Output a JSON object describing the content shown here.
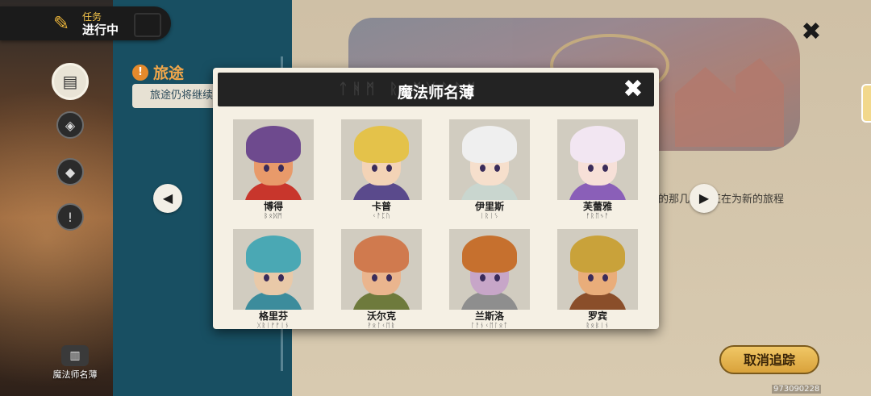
{
  "task": {
    "label": "任务",
    "status": "进行中"
  },
  "journey": {
    "title": "旅途",
    "text": "旅途仍将继续"
  },
  "story": {
    "text": "的那几…是正在为新的旅程"
  },
  "roster": {
    "label": "魔法师名薄"
  },
  "modal": {
    "title": "魔法师名薄",
    "rune_title": "ᛏᚻᛗ ᚱ ᛗᚷᛚᚨᛗ"
  },
  "mages": [
    {
      "name": "博得",
      "rune": "ᛒᛟᛞᛗ",
      "hair": "#6e4a8e",
      "skin": "#e89a6a",
      "body": "#c8362c"
    },
    {
      "name": "卡普",
      "rune": "ᚲᚨᛈᚢ",
      "hair": "#e4c24a",
      "skin": "#f3d3b6",
      "body": "#5a4a8c"
    },
    {
      "name": "伊里斯",
      "rune": "ᛁᚱᛁᛊ",
      "hair": "#efefef",
      "skin": "#f6dfcc",
      "body": "#c9d6cf"
    },
    {
      "name": "芙蕾雅",
      "rune": "ᚠᚱᛖᛃᚨ",
      "hair": "#f2e6f2",
      "skin": "#f7e0d8",
      "body": "#8a5fb8"
    },
    {
      "name": "格里芬",
      "rune": "ᚷᚱᛁᚠᚠᛁᚾ",
      "hair": "#4aa8b4",
      "skin": "#e9c9a8",
      "body": "#3c8c9c"
    },
    {
      "name": "沃尔克",
      "rune": "ᚹᛟᛚᚲᛖᚱ",
      "hair": "#d07a4e",
      "skin": "#eab58e",
      "body": "#6e7a3c"
    },
    {
      "name": "兰斯洛",
      "rune": "ᛚᚨᚾᚲᛖᛚᛟᛏ",
      "hair": "#c6702e",
      "skin": "#c7a6c8",
      "body": "#8e8e8e"
    },
    {
      "name": "罗宾",
      "rune": "ᚱᛟᛒᛁᚾ",
      "hair": "#c9a23a",
      "skin": "#e9ad7a",
      "body": "#8a4e2a"
    }
  ],
  "cancel_button": "取消追踪",
  "uid": "973090228",
  "icons": {
    "task": "scroll-icon",
    "close": "close-icon",
    "prev": "arrow-left-icon",
    "next": "arrow-right-icon",
    "roster": "book-icon"
  },
  "colors": {
    "accent": "#e9b33a",
    "panel": "#184f62",
    "parchment": "#d8cab0"
  }
}
